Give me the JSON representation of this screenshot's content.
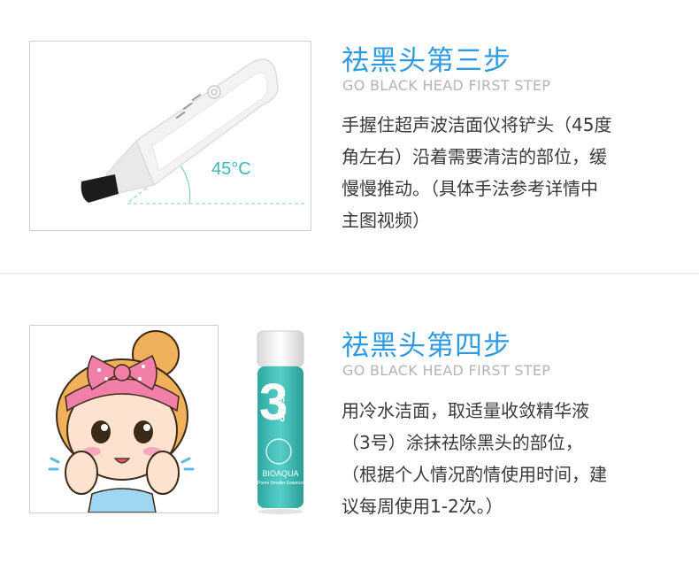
{
  "step3": {
    "title": "祛黑头第三步",
    "subtitle": "GO BLACK HEAD FIRST STEP",
    "angle_label": "45°C",
    "lines": [
      "手握住超声波洁面仪将铲头（45度",
      "角左右）沿着需要清洁的部位，缓",
      "慢慢推动。（具体手法参考详情中",
      "主图视频）"
    ]
  },
  "step4": {
    "title": "祛黑头第四步",
    "subtitle": "GO BLACK HEAD FIRST STEP",
    "bottle": {
      "big_number": "3",
      "step_word": "STEP",
      "brand": "BIOAQUA",
      "product": "Pores Smaller Essence"
    },
    "lines": [
      "用冷水洁面，取适量收敛精华液",
      "（3号）涂抹祛除黑头的部位，",
      "（根据个人情况酌情使用时间，建",
      "议每周使用1-2次。）"
    ]
  },
  "colors": {
    "title_blue": "#2e9be0",
    "subtitle_gray": "#b4b4b4",
    "text": "#3a3a3a",
    "accent_teal": "#3fb8b3",
    "bow_pink": "#f27fa8"
  }
}
